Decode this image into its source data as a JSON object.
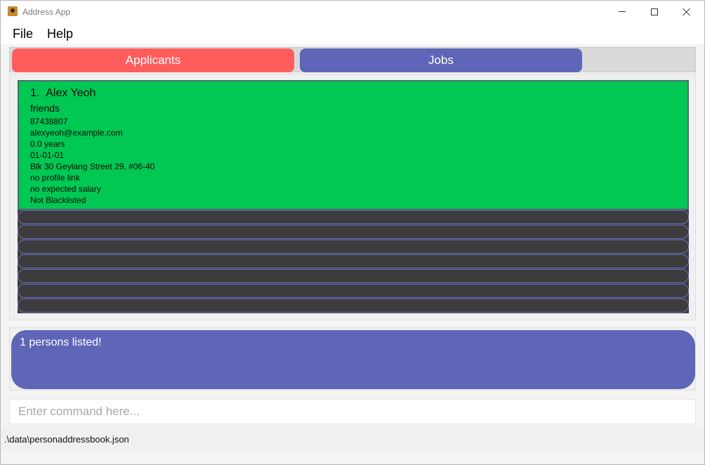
{
  "window": {
    "title": "Address App",
    "icon": "address-book-icon",
    "controls": {
      "minimize": "minimize-icon",
      "maximize": "maximize-icon",
      "close": "close-icon"
    }
  },
  "menu": {
    "file": "File",
    "help": "Help"
  },
  "tabs": [
    {
      "label": "Applicants",
      "color": "#ff5c5c",
      "selected": true
    },
    {
      "label": "Jobs",
      "color": "#5f66b8",
      "selected": false
    }
  ],
  "persons": [
    {
      "index": "1.",
      "name": "Alex Yeoh",
      "tag": "friends",
      "phone": "87438807",
      "email": "alexyeoh@example.com",
      "experience": "0.0 years",
      "date": "01-01-01",
      "address": "Blk 30 Geylang Street 29, #06-40",
      "profile": "no profile link",
      "salary": "no expected salary",
      "blacklist": "Not Blacklisted"
    }
  ],
  "result": {
    "message": "1 persons listed!"
  },
  "command": {
    "placeholder": "Enter command here...",
    "value": ""
  },
  "status": {
    "path": ".\\data\\personaddressbook.json"
  },
  "colors": {
    "card_selected": "#00c853",
    "list_background": "#3c3c3c",
    "result_background": "#5f66b8"
  }
}
